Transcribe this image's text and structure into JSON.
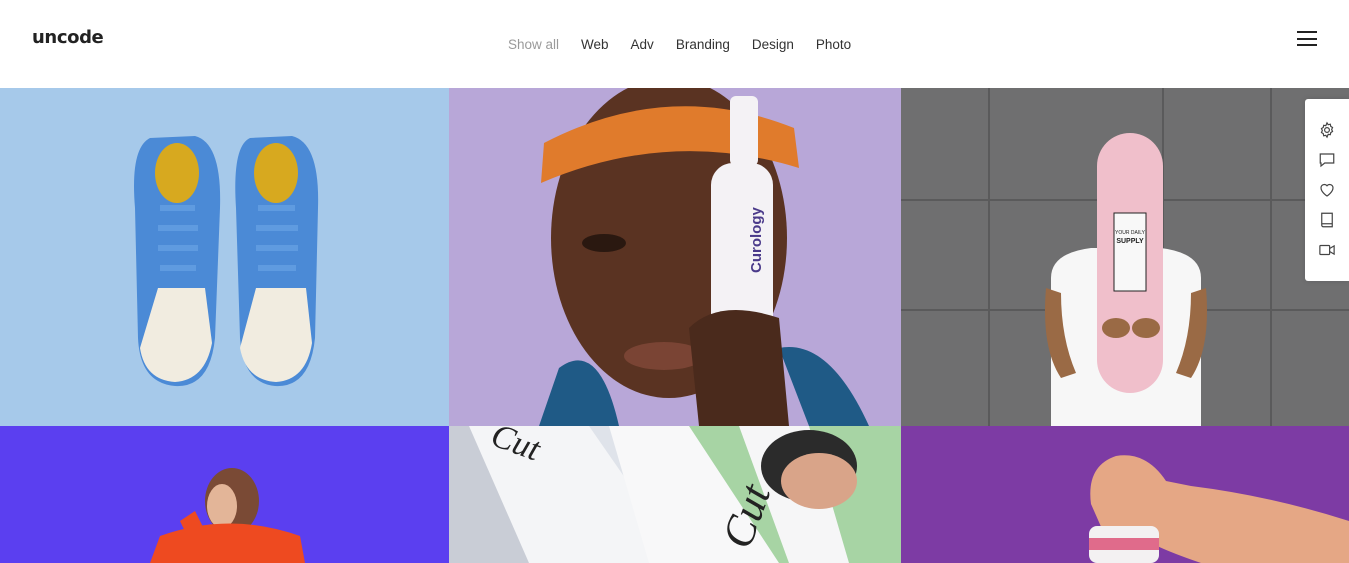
{
  "header": {
    "logo": "uncode",
    "filters": [
      {
        "label": "Show all",
        "active": true
      },
      {
        "label": "Web"
      },
      {
        "label": "Adv"
      },
      {
        "label": "Branding"
      },
      {
        "label": "Design"
      },
      {
        "label": "Photo"
      }
    ],
    "menu_icon": "hamburger-icon"
  },
  "portfolio": {
    "tiles": [
      {
        "subject": "blue-sneakers"
      },
      {
        "subject": "man-with-bottle",
        "product_text": "Curology"
      },
      {
        "subject": "skateboard-deck",
        "deck_text": [
          "YOUR DAILY",
          "SUPPLY"
        ]
      },
      {
        "subject": "woman-orange-jacket"
      },
      {
        "subject": "magazines",
        "cover_text": "Cut"
      },
      {
        "subject": "hand-with-can"
      }
    ]
  },
  "side_tools": [
    {
      "icon": "gear-icon"
    },
    {
      "icon": "comment-icon"
    },
    {
      "icon": "heart-icon"
    },
    {
      "icon": "book-icon"
    },
    {
      "icon": "video-icon"
    }
  ],
  "colors": {
    "accent_inactive": "#9a9a9a",
    "text": "#333333"
  }
}
